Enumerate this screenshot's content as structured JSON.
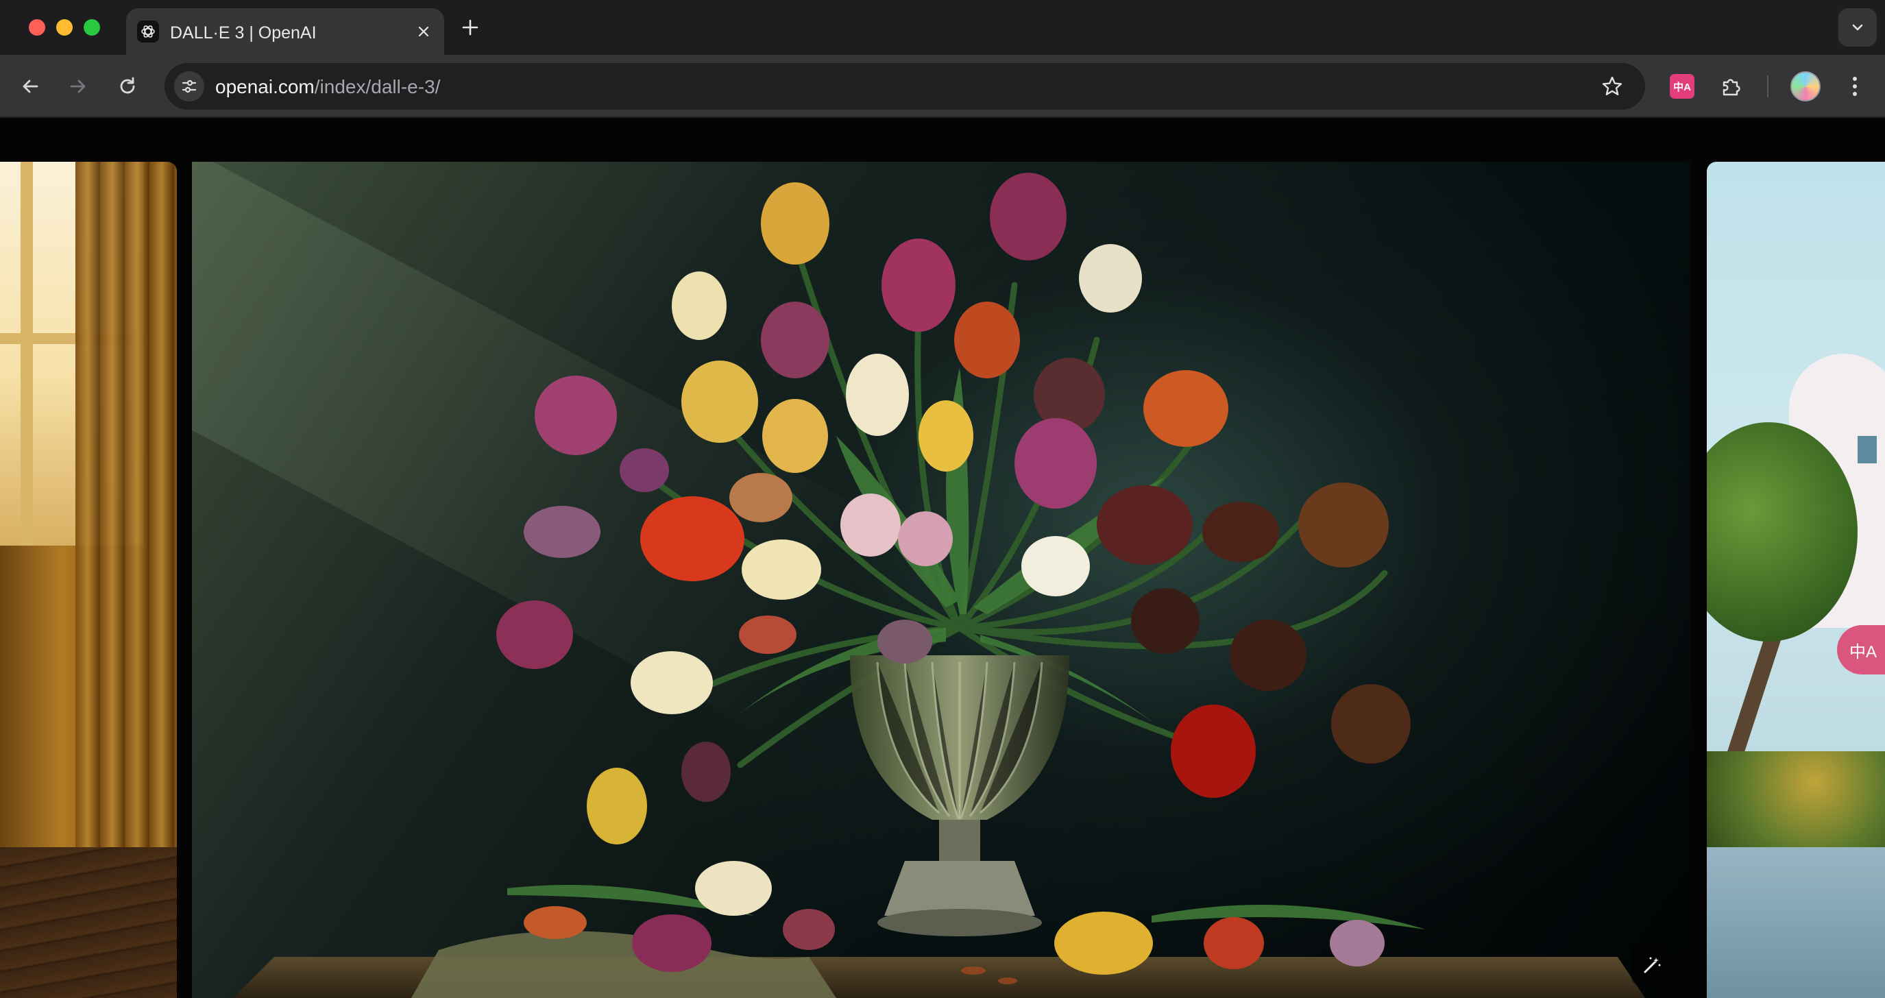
{
  "browser": {
    "tab": {
      "title": "DALL·E 3 | OpenAI",
      "favicon": "openai-logo-icon"
    },
    "url": {
      "host": "openai.com",
      "path": "/index/dall-e-3/"
    },
    "buttons": [
      "back",
      "forward",
      "reload",
      "site-info",
      "bookmark-star",
      "extensions",
      "profile",
      "menu"
    ],
    "extension_label": "中A"
  },
  "page": {
    "main_image": "still life painting of tulips in a fluted glass vase on a draped table",
    "left_image": "sunlit window with golden curtain",
    "right_image": "white building with tree by the water",
    "floating_translate_label": "中A"
  },
  "colors": {
    "tab_bar": "#1d1d1f",
    "toolbar": "#353538",
    "omnibox": "#202022",
    "page_bg": "#040404",
    "translate_ext": "#e33d7a"
  }
}
